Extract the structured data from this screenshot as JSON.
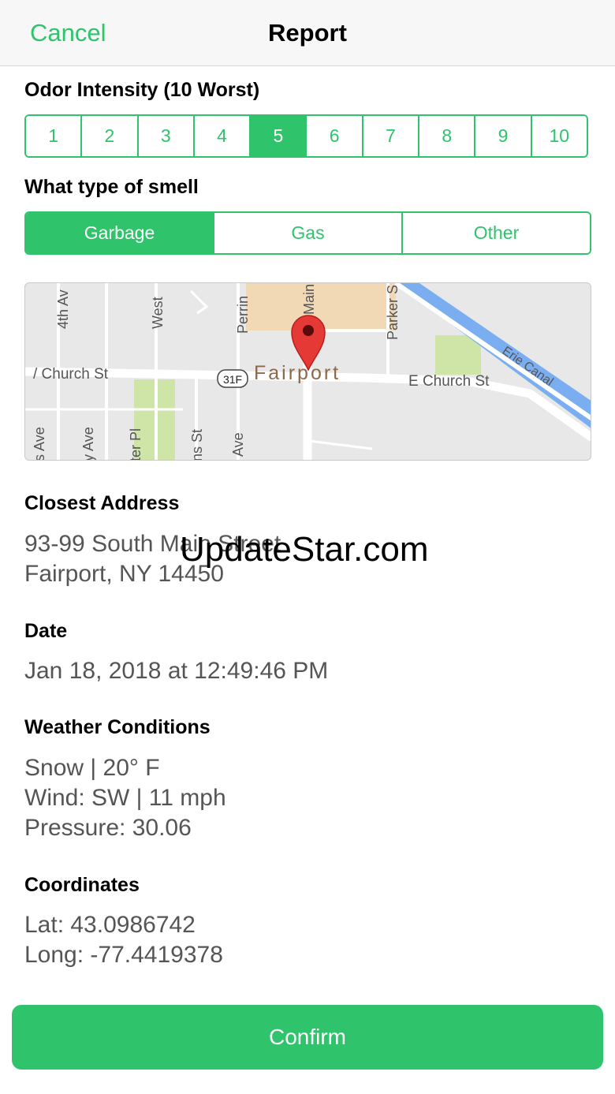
{
  "navbar": {
    "cancel_label": "Cancel",
    "title": "Report"
  },
  "intensity": {
    "label": "Odor Intensity (10 Worst)",
    "options": [
      "1",
      "2",
      "3",
      "4",
      "5",
      "6",
      "7",
      "8",
      "9",
      "10"
    ],
    "selected": "5"
  },
  "smell": {
    "label": "What type of smell",
    "options": [
      "Garbage",
      "Gas",
      "Other"
    ],
    "selected": "Garbage"
  },
  "map": {
    "town": "Fairport",
    "route_shield": "31F",
    "streets": {
      "w_church": "/ Church St",
      "e_church": "E Church St",
      "fourth_ave": "4th Av",
      "west": "West",
      "perrin": "Perrin",
      "main": "Main",
      "parker": "Parker S",
      "canal": "Erie Canal",
      "ave_a": "s Ave",
      "ave_b": "y Ave",
      "pl": "ter Pl",
      "st_b": "ns St",
      "ave_c": "Ave"
    }
  },
  "address": {
    "label": "Closest Address",
    "line1": "93-99 South Main Street",
    "line2": "Fairport, NY 14450"
  },
  "date": {
    "label": "Date",
    "value": "Jan 18, 2018 at 12:49:46 PM"
  },
  "weather": {
    "label": "Weather Conditions",
    "line1": "Snow | 20° F",
    "line2": "Wind: SW | 11 mph",
    "line3": "Pressure: 30.06"
  },
  "coordinates": {
    "label": "Coordinates",
    "lat": "Lat: 43.0986742",
    "long": "Long: -77.4419378"
  },
  "watermark": "UpdateStar.com",
  "confirm_label": "Confirm",
  "colors": {
    "accent": "#2fc46b",
    "value_text": "#555555",
    "pin": "#e53935",
    "water": "#7aaef0"
  }
}
